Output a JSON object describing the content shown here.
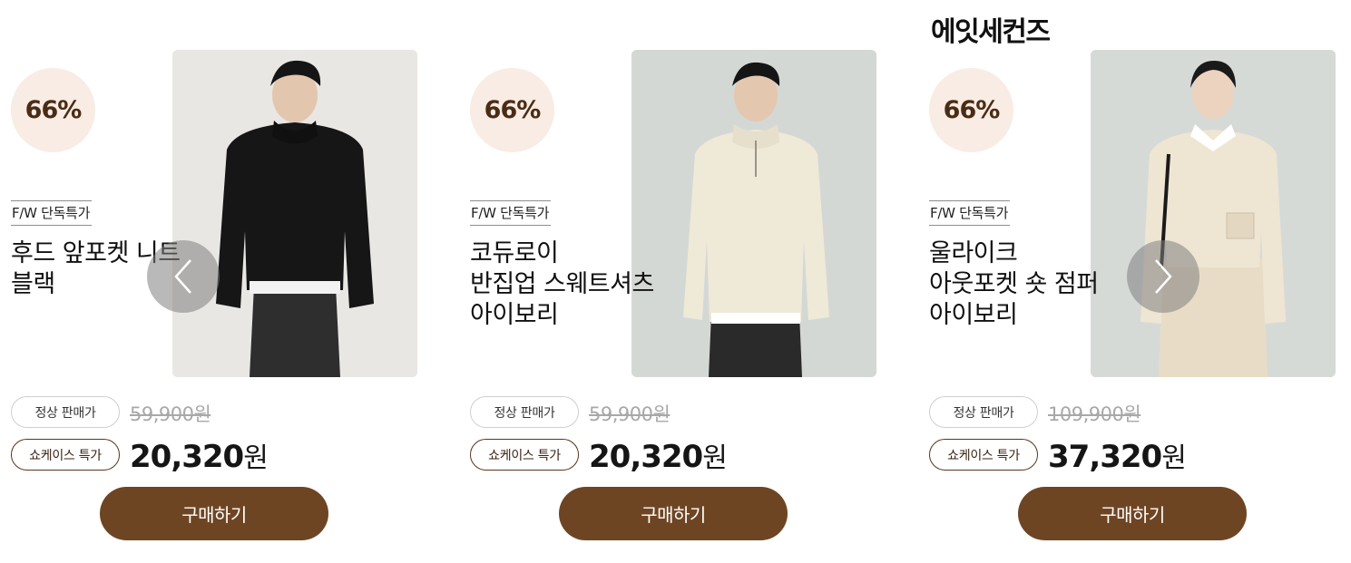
{
  "brand": {
    "title": "에잇세컨즈"
  },
  "colors": {
    "discount_bg": "#f8ece4",
    "discount_text": "#4a2c14",
    "buy_button": "#6e4523",
    "sale_pill_border": "#5a3519"
  },
  "carousel": {
    "prev_icon": "chevron-left-icon",
    "next_icon": "chevron-right-icon"
  },
  "products": [
    {
      "discount": "66%",
      "tag": "F/W 단독특가",
      "name_lines": [
        "후드 앞포켓 니트",
        "블랙"
      ],
      "regular_label": "정상 판매가",
      "regular_price": "59,900원",
      "sale_label": "쇼케이스 특가",
      "sale_price_number": "20,320",
      "sale_price_unit": "원",
      "buy_label": "구매하기"
    },
    {
      "discount": "66%",
      "tag": "F/W 단독특가",
      "name_lines": [
        "코듀로이",
        "반집업 스웨트셔츠",
        "아이보리"
      ],
      "regular_label": "정상 판매가",
      "regular_price": "59,900원",
      "sale_label": "쇼케이스 특가",
      "sale_price_number": "20,320",
      "sale_price_unit": "원",
      "buy_label": "구매하기"
    },
    {
      "discount": "66%",
      "tag": "F/W 단독특가",
      "name_lines": [
        "울라이크",
        "아웃포켓 숏 점퍼",
        "아이보리"
      ],
      "regular_label": "정상 판매가",
      "regular_price": "109,900원",
      "sale_label": "쇼케이스 특가",
      "sale_price_number": "37,320",
      "sale_price_unit": "원",
      "buy_label": "구매하기"
    }
  ]
}
